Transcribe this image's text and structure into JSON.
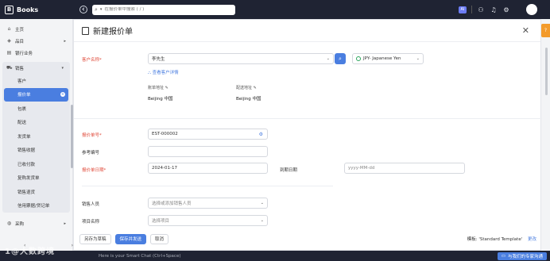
{
  "app": {
    "name": "Books"
  },
  "topbar": {
    "search_placeholder": "在报价单中搜索 ( / )",
    "ai_badge": "AI"
  },
  "sidebar": {
    "items": [
      {
        "label": "主页",
        "icon": "home-icon",
        "glyph": "⌂"
      },
      {
        "label": "品目",
        "icon": "tag-icon",
        "glyph": "◈",
        "arrow": "▸"
      },
      {
        "label": "银行业务",
        "icon": "bank-icon",
        "glyph": "▤"
      }
    ],
    "group": {
      "label": "销售",
      "icon": "cart-icon",
      "glyph": "⛟",
      "arrow": "▾"
    },
    "sub_items": [
      "客户",
      "报价单",
      "包裹",
      "配送",
      "发货单",
      "销售收据",
      "已收付款",
      "复购发货单",
      "销售退货",
      "信用票据/贷记单"
    ],
    "active_index": 1,
    "bottom": {
      "label": "采购",
      "icon": "bag-icon",
      "glyph": "◍",
      "arrow": "▸"
    }
  },
  "form": {
    "title": "新建报价单",
    "customer": {
      "label": "客户名称*",
      "value": "李先生"
    },
    "currency": {
      "value": "JPY- Japanese Yen"
    },
    "view_details": "查看客户详情",
    "billing_label": "账单地址",
    "billing_value": "Beijing 中国",
    "shipping_label": "配送地址",
    "shipping_value": "Beijing 中国",
    "quote_no": {
      "label": "报价单号*",
      "value": "EST-000002"
    },
    "ref_no": {
      "label": "参考编号",
      "value": ""
    },
    "quote_date": {
      "label": "报价单日期*",
      "value": "2024-01-17"
    },
    "expiry": {
      "label": "到期日期",
      "placeholder": "yyyy-MM-dd"
    },
    "salesperson": {
      "label": "销售人员",
      "placeholder": "选择或添加销售人员"
    },
    "project": {
      "label": "项目名称",
      "placeholder": "选择项目"
    }
  },
  "footer": {
    "save_draft": "另存为草稿",
    "save_send": "保存并发送",
    "cancel": "取消",
    "template_label": "模板:",
    "template_value": "'Standard Template'",
    "change": "更改"
  },
  "chat": {
    "placeholder": "Here is your Smart Chat (Ctrl+Space)",
    "button": "与我们的专家沟通"
  },
  "watermark": "1@大数跨境"
}
